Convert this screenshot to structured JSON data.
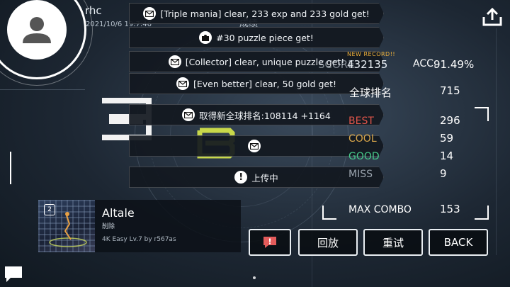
{
  "player": {
    "username": "rhc",
    "datetime": "2021/10/6 19:7:46"
  },
  "notices": [
    {
      "icon": "mail-icon",
      "text": "[Triple mania] clear, 233 exp and 233 gold get!"
    },
    {
      "icon": "puzzle-icon",
      "text": "#30 puzzle piece get!"
    },
    {
      "icon": "mail-icon",
      "text": "[Collector] clear, unique puzzle get!"
    },
    {
      "icon": "mail-icon",
      "text": "[Even better] clear, 50 gold get!"
    },
    {
      "icon": "mail-icon",
      "text": "取得新全球排名:108114 +1164"
    },
    {
      "icon": "mail-icon",
      "text": ""
    },
    {
      "icon": "alert-icon",
      "text": "上传中"
    }
  ],
  "section_title": "成绩",
  "result": {
    "rank_digit": "3",
    "grade": "B",
    "new_record": "NEW RECORD!!",
    "score_label": "SCORE",
    "score": "432135",
    "acc_label": "ACC.",
    "acc": "91.49%",
    "global_rank_label": "全球排名",
    "global_rank": "715",
    "judgements": [
      {
        "label": "BEST",
        "value": "296",
        "color": "#e0554a"
      },
      {
        "label": "COOL",
        "value": "59",
        "color": "#d9a64a"
      },
      {
        "label": "GOOD",
        "value": "14",
        "color": "#47c98a"
      },
      {
        "label": "MISS",
        "value": "9",
        "color": "#9aa3ad"
      }
    ],
    "max_combo_label": "MAX COMBO",
    "max_combo": "153"
  },
  "song": {
    "title": "Altale",
    "subtitle": "削除",
    "difficulty": "4K Easy Lv.7 by r567as"
  },
  "buttons": {
    "replay": "回放",
    "retry": "重试",
    "back": "BACK"
  },
  "colors": {
    "grade_b": "#c8d84a",
    "new_record": "#f0b23a",
    "report_button": "#e35b5b"
  }
}
